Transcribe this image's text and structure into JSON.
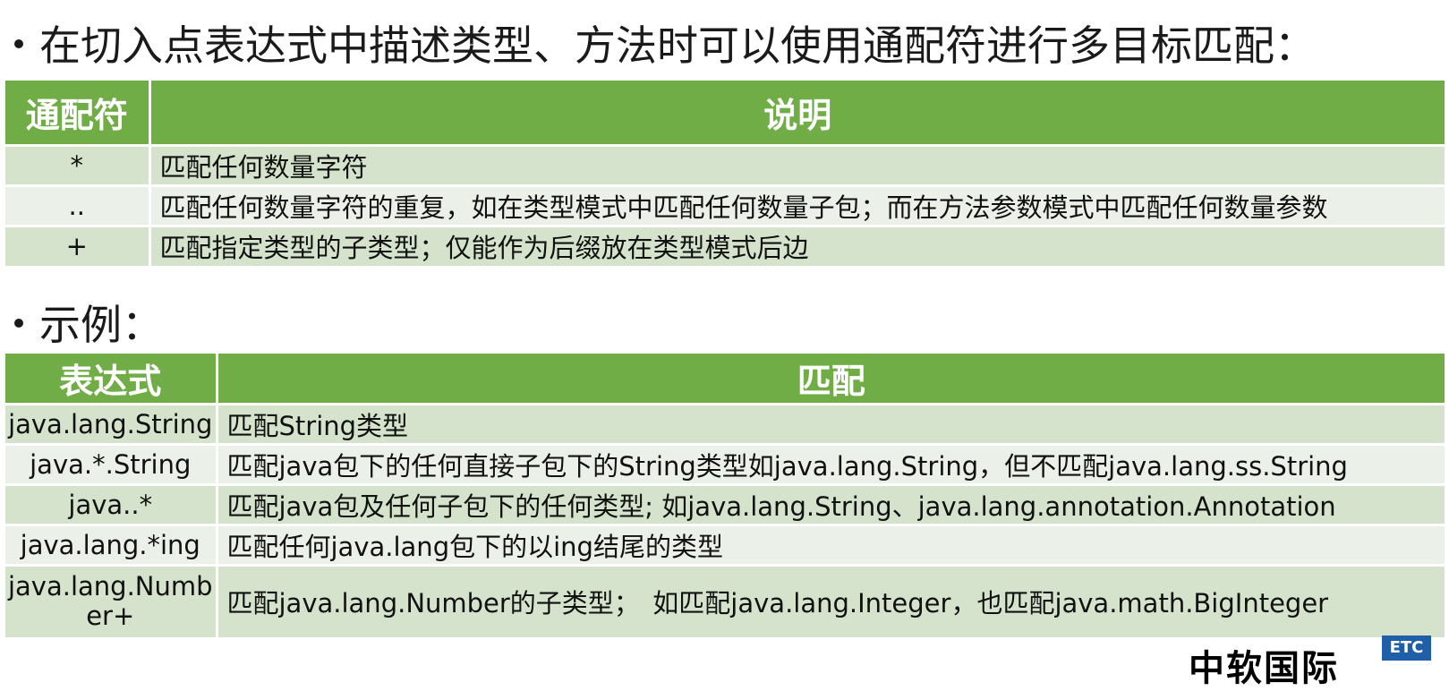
{
  "bullet1": "在切入点表达式中描述类型、方法时可以使用通配符进行多目标匹配：",
  "wildcard_table": {
    "headers": [
      "通配符",
      "说明"
    ],
    "rows": [
      [
        "*",
        "匹配任何数量字符"
      ],
      [
        "..",
        "匹配任何数量字符的重复，如在类型模式中匹配任何数量子包；而在方法参数模式中匹配任何数量参数"
      ],
      [
        "+",
        "匹配指定类型的子类型；仅能作为后缀放在类型模式后边"
      ]
    ]
  },
  "bullet2": "示例：",
  "example_table": {
    "headers": [
      "表达式",
      "匹配"
    ],
    "rows": [
      [
        "java.lang.String",
        "匹配String类型"
      ],
      [
        "java.*.String",
        "匹配java包下的任何直接子包下的String类型如java.lang.String，但不匹配java.lang.ss.String"
      ],
      [
        "java..*",
        "匹配java包及任何子包下的任何类型; 如java.lang.String、java.lang.annotation.Annotation"
      ],
      [
        "java.lang.*ing",
        "匹配任何java.lang包下的以ing结尾的类型"
      ],
      [
        "java.lang.Number+",
        "匹配java.lang.Number的子类型；　如匹配java.lang.Integer，也匹配java.math.BigInteger"
      ]
    ]
  },
  "logo": {
    "text": "中软国际",
    "badge": "ETC"
  },
  "colors": {
    "header_green": "#70ad47",
    "row_dark": "#d5e3cc",
    "row_light": "#ebf1e8"
  }
}
